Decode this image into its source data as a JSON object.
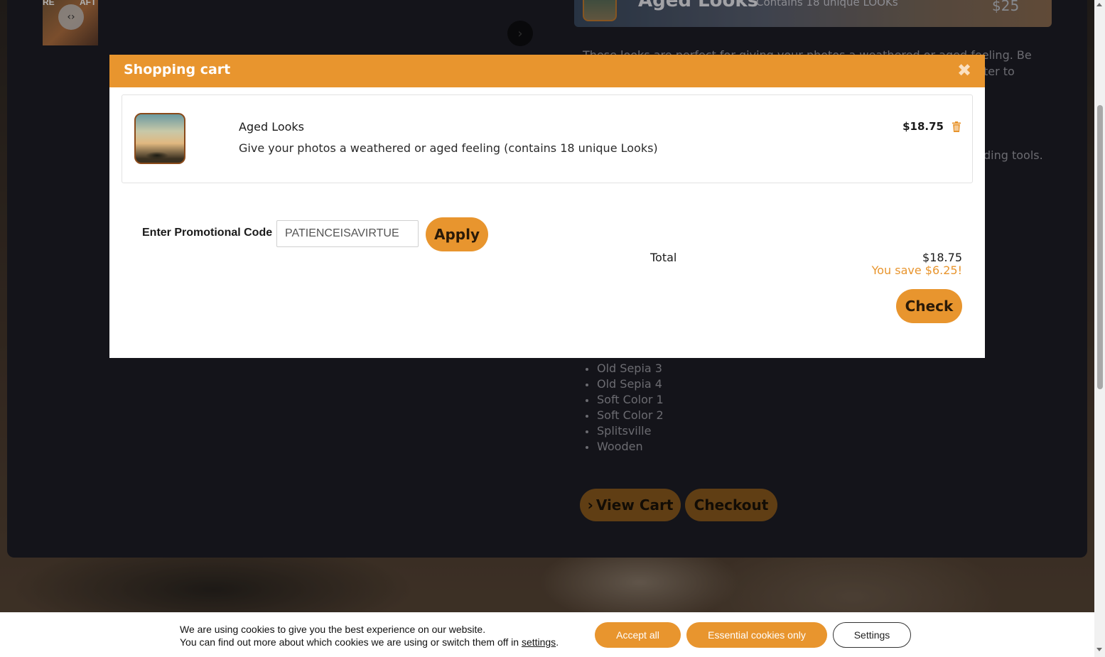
{
  "background": {
    "thumbnail": {
      "label_left": "RE",
      "label_right": "AFT"
    },
    "banner": {
      "title": "Aged Looks",
      "subtitle": "Contains 18 unique LOOKs",
      "price": "$25"
    },
    "description": {
      "line1": "These looks are perfect for giving your photos a weathered or aged feeling. Be",
      "line2": "ter to",
      "line3": "ding tools."
    },
    "look_list": [
      "Old Sepia 3",
      "Old Sepia 4",
      "Soft Color 1",
      "Soft Color 2",
      "Splitsville",
      "Wooden"
    ],
    "view_cart_label": "View Cart",
    "checkout_label": "Checkout"
  },
  "modal": {
    "title": "Shopping cart",
    "item": {
      "name": "Aged Looks",
      "description": "Give your photos a weathered or aged feeling (contains 18 unique Looks)",
      "price": "$18.75"
    },
    "promo": {
      "label": "Enter Promotional Code",
      "value": "PATIENCEISAVIRTUE",
      "apply_label": "Apply"
    },
    "total_label": "Total",
    "total_value": "$18.75",
    "savings": "You save $6.25!",
    "check_label": "Check"
  },
  "cookie_bar": {
    "line1": "We are using cookies to give you the best experience on our website.",
    "line2_prefix": "You can find out more about which cookies we are using or switch them off in",
    "line2_link": "settings",
    "line2_suffix": ".",
    "accept_all": "Accept all",
    "essential_only": "Essential cookies only",
    "settings": "Settings"
  },
  "colors": {
    "accent": "#e8952e",
    "page_panel": "#1e1e26",
    "modal_bg": "#ffffff"
  },
  "icons": {
    "close": "close-icon",
    "trash": "trash-icon",
    "chevron": "chevron-right-icon",
    "compare": "compare-arrows-icon"
  }
}
